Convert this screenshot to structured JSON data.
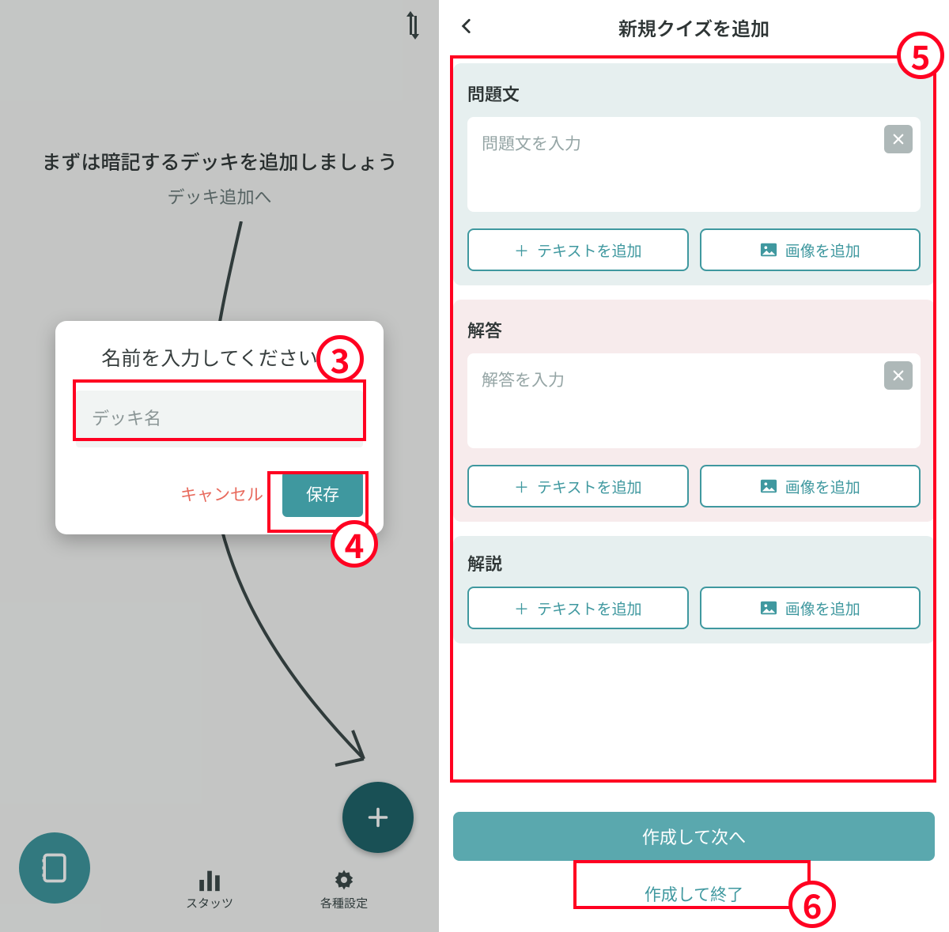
{
  "left": {
    "heading": "まずは暗記するデッキを追加しましょう",
    "sub": "デッキ追加へ",
    "nav": {
      "stats": "スタッツ",
      "settings": "各種設定"
    },
    "fab_icons": {
      "add": "plus-icon",
      "book": "book-icon"
    },
    "dialog": {
      "title": "名前を入力してください。",
      "placeholder": "デッキ名",
      "cancel": "キャンセル",
      "save": "保存"
    }
  },
  "right": {
    "title": "新規クイズを追加",
    "question": {
      "label": "問題文",
      "placeholder": "問題文を入力",
      "add_text": "テキストを追加",
      "add_image": "画像を追加"
    },
    "answer": {
      "label": "解答",
      "placeholder": "解答を入力",
      "add_text": "テキストを追加",
      "add_image": "画像を追加"
    },
    "explain": {
      "label": "解説",
      "add_text": "テキストを追加",
      "add_image": "画像を追加"
    },
    "next": "作成して次へ",
    "finish": "作成して終了"
  },
  "badges": {
    "b3": "3",
    "b4": "4",
    "b5": "5",
    "b6": "6"
  },
  "colors": {
    "accent": "#3f989f",
    "danger": "#ff0021"
  }
}
